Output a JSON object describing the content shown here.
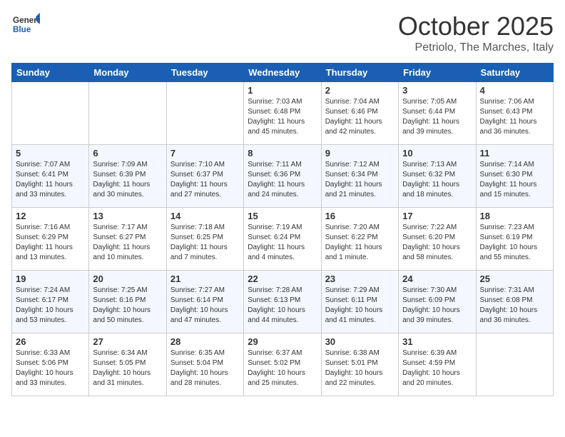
{
  "header": {
    "logo_general": "General",
    "logo_blue": "Blue",
    "month_title": "October 2025",
    "location": "Petriolo, The Marches, Italy"
  },
  "days_of_week": [
    "Sunday",
    "Monday",
    "Tuesday",
    "Wednesday",
    "Thursday",
    "Friday",
    "Saturday"
  ],
  "weeks": [
    [
      {
        "day": "",
        "info": ""
      },
      {
        "day": "",
        "info": ""
      },
      {
        "day": "",
        "info": ""
      },
      {
        "day": "1",
        "info": "Sunrise: 7:03 AM\nSunset: 6:48 PM\nDaylight: 11 hours and 45 minutes."
      },
      {
        "day": "2",
        "info": "Sunrise: 7:04 AM\nSunset: 6:46 PM\nDaylight: 11 hours and 42 minutes."
      },
      {
        "day": "3",
        "info": "Sunrise: 7:05 AM\nSunset: 6:44 PM\nDaylight: 11 hours and 39 minutes."
      },
      {
        "day": "4",
        "info": "Sunrise: 7:06 AM\nSunset: 6:43 PM\nDaylight: 11 hours and 36 minutes."
      }
    ],
    [
      {
        "day": "5",
        "info": "Sunrise: 7:07 AM\nSunset: 6:41 PM\nDaylight: 11 hours and 33 minutes."
      },
      {
        "day": "6",
        "info": "Sunrise: 7:09 AM\nSunset: 6:39 PM\nDaylight: 11 hours and 30 minutes."
      },
      {
        "day": "7",
        "info": "Sunrise: 7:10 AM\nSunset: 6:37 PM\nDaylight: 11 hours and 27 minutes."
      },
      {
        "day": "8",
        "info": "Sunrise: 7:11 AM\nSunset: 6:36 PM\nDaylight: 11 hours and 24 minutes."
      },
      {
        "day": "9",
        "info": "Sunrise: 7:12 AM\nSunset: 6:34 PM\nDaylight: 11 hours and 21 minutes."
      },
      {
        "day": "10",
        "info": "Sunrise: 7:13 AM\nSunset: 6:32 PM\nDaylight: 11 hours and 18 minutes."
      },
      {
        "day": "11",
        "info": "Sunrise: 7:14 AM\nSunset: 6:30 PM\nDaylight: 11 hours and 15 minutes."
      }
    ],
    [
      {
        "day": "12",
        "info": "Sunrise: 7:16 AM\nSunset: 6:29 PM\nDaylight: 11 hours and 13 minutes."
      },
      {
        "day": "13",
        "info": "Sunrise: 7:17 AM\nSunset: 6:27 PM\nDaylight: 11 hours and 10 minutes."
      },
      {
        "day": "14",
        "info": "Sunrise: 7:18 AM\nSunset: 6:25 PM\nDaylight: 11 hours and 7 minutes."
      },
      {
        "day": "15",
        "info": "Sunrise: 7:19 AM\nSunset: 6:24 PM\nDaylight: 11 hours and 4 minutes."
      },
      {
        "day": "16",
        "info": "Sunrise: 7:20 AM\nSunset: 6:22 PM\nDaylight: 11 hours and 1 minute."
      },
      {
        "day": "17",
        "info": "Sunrise: 7:22 AM\nSunset: 6:20 PM\nDaylight: 10 hours and 58 minutes."
      },
      {
        "day": "18",
        "info": "Sunrise: 7:23 AM\nSunset: 6:19 PM\nDaylight: 10 hours and 55 minutes."
      }
    ],
    [
      {
        "day": "19",
        "info": "Sunrise: 7:24 AM\nSunset: 6:17 PM\nDaylight: 10 hours and 53 minutes."
      },
      {
        "day": "20",
        "info": "Sunrise: 7:25 AM\nSunset: 6:16 PM\nDaylight: 10 hours and 50 minutes."
      },
      {
        "day": "21",
        "info": "Sunrise: 7:27 AM\nSunset: 6:14 PM\nDaylight: 10 hours and 47 minutes."
      },
      {
        "day": "22",
        "info": "Sunrise: 7:28 AM\nSunset: 6:13 PM\nDaylight: 10 hours and 44 minutes."
      },
      {
        "day": "23",
        "info": "Sunrise: 7:29 AM\nSunset: 6:11 PM\nDaylight: 10 hours and 41 minutes."
      },
      {
        "day": "24",
        "info": "Sunrise: 7:30 AM\nSunset: 6:09 PM\nDaylight: 10 hours and 39 minutes."
      },
      {
        "day": "25",
        "info": "Sunrise: 7:31 AM\nSunset: 6:08 PM\nDaylight: 10 hours and 36 minutes."
      }
    ],
    [
      {
        "day": "26",
        "info": "Sunrise: 6:33 AM\nSunset: 5:06 PM\nDaylight: 10 hours and 33 minutes."
      },
      {
        "day": "27",
        "info": "Sunrise: 6:34 AM\nSunset: 5:05 PM\nDaylight: 10 hours and 31 minutes."
      },
      {
        "day": "28",
        "info": "Sunrise: 6:35 AM\nSunset: 5:04 PM\nDaylight: 10 hours and 28 minutes."
      },
      {
        "day": "29",
        "info": "Sunrise: 6:37 AM\nSunset: 5:02 PM\nDaylight: 10 hours and 25 minutes."
      },
      {
        "day": "30",
        "info": "Sunrise: 6:38 AM\nSunset: 5:01 PM\nDaylight: 10 hours and 22 minutes."
      },
      {
        "day": "31",
        "info": "Sunrise: 6:39 AM\nSunset: 4:59 PM\nDaylight: 10 hours and 20 minutes."
      },
      {
        "day": "",
        "info": ""
      }
    ]
  ]
}
